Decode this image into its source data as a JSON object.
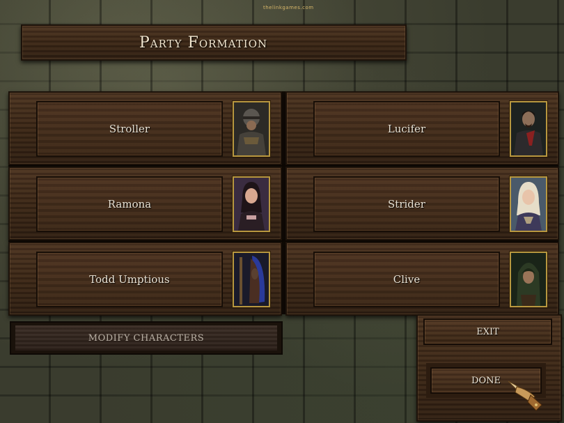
{
  "header": {
    "logo_text": "thelinkgames.com",
    "title": "Party Formation"
  },
  "party": {
    "slots": [
      {
        "name": "Stroller",
        "portrait": "armored-warrior-portrait-icon"
      },
      {
        "name": "Lucifer",
        "portrait": "dark-noble-portrait-icon"
      },
      {
        "name": "Ramona",
        "portrait": "dark-haired-woman-portrait-icon"
      },
      {
        "name": "Strider",
        "portrait": "blonde-woman-portrait-icon"
      },
      {
        "name": "Todd  Umptious",
        "portrait": "hooded-figure-portrait-icon"
      },
      {
        "name": "Clive",
        "portrait": "hooded-ranger-portrait-icon"
      }
    ]
  },
  "actions": {
    "modify_label": "MODIFY CHARACTERS",
    "exit_label": "EXIT",
    "done_label": "DONE"
  },
  "cursor": {
    "icon": "gauntlet-pointer-icon"
  },
  "colors": {
    "portrait_frame": "#b8973f",
    "text_light": "#e9e2d4",
    "wood": "#3b2717"
  }
}
